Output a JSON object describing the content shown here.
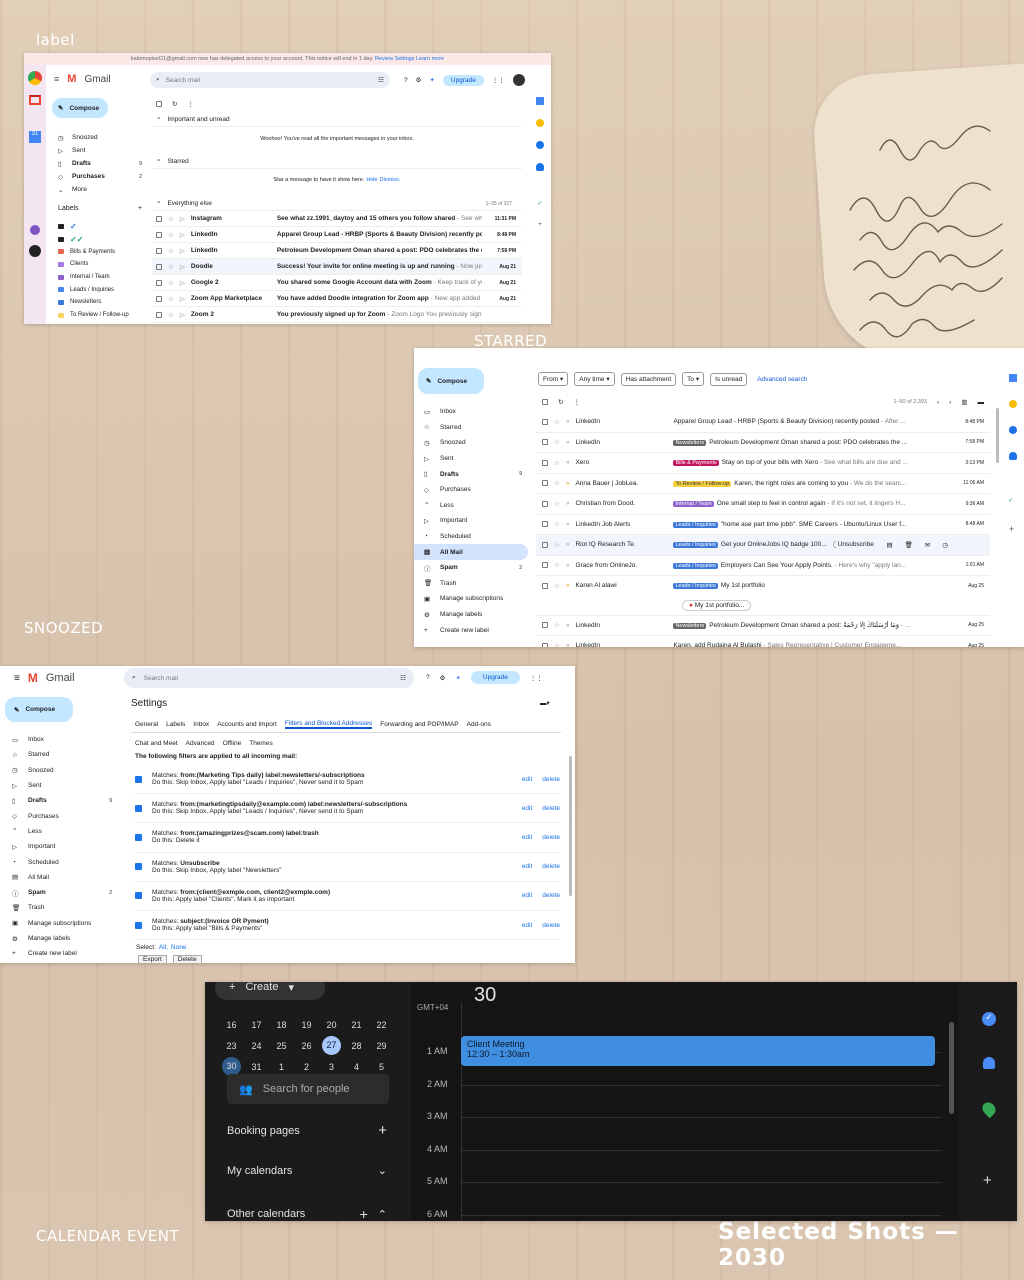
{
  "captions": {
    "label": "label",
    "starred": "STARRED",
    "snoozed": "SNOOZED",
    "calendar_event": "CALENDAR EVENT",
    "footer": "Selected Shots — 2030"
  },
  "colors": {
    "gmail_blue": "#0b57d0",
    "compose_bg": "#c2e7ff",
    "calendar_event": "#3f8ee0",
    "calendar_bg": "#1b1b1b",
    "upgrade_bg": "#c2e7ff"
  },
  "shot1": {
    "notice": "kalomopiseO1@gmail.com now has delegated access to your account. This notice will end in 1 day.",
    "notice_links": [
      "Review Settings",
      "Learn more"
    ],
    "app": "Gmail",
    "search_placeholder": "Search mail",
    "upgrade": "Upgrade",
    "compose": "Compose",
    "nav": [
      {
        "label": "Snoozed",
        "icon": "clock-icon",
        "count": ""
      },
      {
        "label": "Sent",
        "icon": "send-icon",
        "count": ""
      },
      {
        "label": "Drafts",
        "icon": "draft-icon",
        "count": "9"
      },
      {
        "label": "Purchases",
        "icon": "tag-icon",
        "count": "2"
      },
      {
        "label": "More",
        "icon": "chevron-down-icon",
        "count": ""
      }
    ],
    "labels_title": "Labels",
    "labels": [
      {
        "name": "✓",
        "color": "#1a73e8"
      },
      {
        "name": "✓✓",
        "color": "#16a765"
      },
      {
        "name": "Bills & Payments",
        "color": "#e66550"
      },
      {
        "name": "Clients",
        "color": "#a479e2"
      },
      {
        "name": "Internal / Team",
        "color": "#8e63ce"
      },
      {
        "name": "Leads / Inquiries",
        "color": "#4986e7"
      },
      {
        "name": "Newsletters",
        "color": "#3c78d8"
      },
      {
        "name": "To Review / Follow-up",
        "color": "#fad165"
      }
    ],
    "sections": {
      "important": "Important and unread",
      "important_msg": "Woohoo! You've read all the important messages in your inbox.",
      "starred": "Starred",
      "starred_msg": "Star a message to have it show here.",
      "starred_links": [
        "Hide",
        "Dismiss."
      ],
      "everything": "Everything else",
      "range": "1–35 of 327"
    },
    "emails": [
      {
        "sender": "Instagram",
        "subject": "See what zz.1991_daytoy and 15 others you follow shared",
        "snippet": " - See what's new...",
        "time": "11:31 PM"
      },
      {
        "sender": "LinkedIn",
        "subject": "Apparel Group Lead - HRBP (Sports & Beauty Division) recently posted",
        "snippet": " - A...",
        "time": "8:48 PM"
      },
      {
        "sender": "LinkedIn",
        "subject": "Petroleum Development Oman shared a post: PDO celebrates the comple...",
        "snippet": "",
        "time": "7:58 PM"
      },
      {
        "sender": "Doodle",
        "subject": "Success! Your invite for online meeting is up and running",
        "snippet": " - Now just invite your ...",
        "time": "Aug 21"
      },
      {
        "sender": "Google 2",
        "subject": "You shared some Google Account data with Zoom",
        "snippet": " - Keep track of your Goo...",
        "time": "Aug 21"
      },
      {
        "sender": "Zoom App Marketplace",
        "subject": "You have added Doodle integration for Zoom app",
        "snippet": " - New app added to your ...",
        "time": "Aug 21"
      },
      {
        "sender": "Zoom 2",
        "subject": "You previously signed up for Zoom",
        "snippet": " - Zoom Logo You previously sign...",
        "time": ""
      }
    ]
  },
  "shot2": {
    "compose": "Compose",
    "filters": [
      "From",
      "Any time",
      "Has attachment",
      "To",
      "Is unread"
    ],
    "advanced": "Advanced search",
    "range": "1–50 of 2,393",
    "nav": [
      {
        "label": "Inbox",
        "icon": "inbox-icon",
        "count": ""
      },
      {
        "label": "Starred",
        "icon": "star-icon",
        "count": ""
      },
      {
        "label": "Snoozed",
        "icon": "clock-icon",
        "count": ""
      },
      {
        "label": "Sent",
        "icon": "send-icon",
        "count": ""
      },
      {
        "label": "Drafts",
        "icon": "draft-icon",
        "count": "9"
      },
      {
        "label": "Purchases",
        "icon": "tag-icon",
        "count": ""
      },
      {
        "label": "Less",
        "icon": "chevron-up-icon",
        "count": ""
      },
      {
        "label": "Important",
        "icon": "important-icon",
        "count": ""
      },
      {
        "label": "Scheduled",
        "icon": "scheduled-icon",
        "count": ""
      },
      {
        "label": "All Mail",
        "icon": "allmail-icon",
        "count": ""
      },
      {
        "label": "Spam",
        "icon": "spam-icon",
        "count": "2"
      },
      {
        "label": "Trash",
        "icon": "trash-icon",
        "count": ""
      },
      {
        "label": "Manage subscriptions",
        "icon": "subscriptions-icon",
        "count": ""
      },
      {
        "label": "Manage labels",
        "icon": "gear-icon",
        "count": ""
      },
      {
        "label": "Create new label",
        "icon": "plus-icon",
        "count": ""
      }
    ],
    "active_nav": "All Mail",
    "emails": [
      {
        "sender": "LinkedIn",
        "chip": "",
        "chip_color": "",
        "subject": "Apparel Group Lead - HRBP (Sports & Beauty Division) recently posted",
        "snippet": " - After ...",
        "time": "8:48 PM"
      },
      {
        "sender": "LinkedIn",
        "chip": "Newsletters",
        "chip_color": "#666",
        "subject": "Petroleum Development Oman shared a post: PDO celebrates the ...",
        "snippet": "",
        "time": "7:58 PM"
      },
      {
        "sender": "Xero",
        "chip": "Bills & Payments",
        "chip_color": "#c2185b",
        "subject": "Stay on top of your bills with Xero",
        "snippet": " - See what bills are due and ...",
        "time": "3:13 PM"
      },
      {
        "sender": "Anna Bauer | JobLea.",
        "chip": "To Review / Follow-up",
        "chip_color": "#f4d03f",
        "subject": "Karen, the right roles are coming to you",
        "snippet": " - We do the searc...",
        "time": "11:06 AM"
      },
      {
        "sender": "Christian from Dood.",
        "chip": "Internal / Team",
        "chip_color": "#8e63ce",
        "subject": "One small step to feel in control again",
        "snippet": " - If it's not set, it lingers H...",
        "time": "9:36 AM"
      },
      {
        "sender": "LinkedIn Job Alerts",
        "chip": "Leads / Inquiries",
        "chip_color": "#3c78d8",
        "subject": "\"home ase part time jobb\": SME Careers - Ubuntu/Linux User f...",
        "snippet": "",
        "time": "8:48 AM"
      },
      {
        "sender": "Riot IQ Research Te.",
        "chip": "Leads / Inquiries",
        "chip_color": "#3c78d8",
        "subject": "Get your OnlineJobs IQ badge 100...",
        "snippet": "",
        "time": "",
        "unsubscribe": "Unsubscribe"
      },
      {
        "sender": "Grace from OnlineJo.",
        "chip": "Leads / Inquiries",
        "chip_color": "#3c78d8",
        "subject": "Employers Can See Your Apply Points.",
        "snippet": " - Here's why \"apply lan...",
        "time": "1:01 AM"
      },
      {
        "sender": "Karen Al alawi",
        "chip": "Leads / Inquiries",
        "chip_color": "#3c78d8",
        "subject": "My 1st portfolio",
        "snippet": "",
        "time": "Aug 25",
        "attachment": "My 1st portfolio..."
      },
      {
        "sender": "LinkedIn",
        "chip": "Newsletters",
        "chip_color": "#666",
        "subject": "Petroleum Development Oman shared a post: وَمَا أَرْسَلْنَاكَ إِلَّا رَحْمَةً",
        "snippet": " - ...",
        "time": "Aug 25"
      },
      {
        "sender": "LinkedIn",
        "chip": "",
        "chip_color": "",
        "subject": "Karen, add Rudaina Al Bulashi",
        "snippet": " - Sales Representative | Customer Engageme...",
        "time": "Aug 25"
      }
    ]
  },
  "shot3": {
    "app": "Gmail",
    "search_placeholder": "Search mail",
    "upgrade": "Upgrade",
    "compose": "Compose",
    "title": "Settings",
    "tabs_row1": [
      "General",
      "Labels",
      "Inbox",
      "Accounts and Import",
      "Filters and Blocked Addresses",
      "Forwarding and POP/IMAP",
      "Add-ons"
    ],
    "tabs_row2": [
      "Chat and Meet",
      "Advanced",
      "Offline",
      "Themes"
    ],
    "active_tab": "Filters and Blocked Addresses",
    "intro": "The following filters are applied to all incoming mail:",
    "nav": [
      {
        "label": "Inbox",
        "count": ""
      },
      {
        "label": "Starred",
        "count": ""
      },
      {
        "label": "Snoozed",
        "count": ""
      },
      {
        "label": "Sent",
        "count": ""
      },
      {
        "label": "Drafts",
        "count": "9"
      },
      {
        "label": "Purchases",
        "count": ""
      },
      {
        "label": "Less",
        "count": ""
      },
      {
        "label": "Important",
        "count": ""
      },
      {
        "label": "Scheduled",
        "count": ""
      },
      {
        "label": "All Mail",
        "count": ""
      },
      {
        "label": "Spam",
        "count": "2"
      },
      {
        "label": "Trash",
        "count": ""
      },
      {
        "label": "Manage subscriptions",
        "count": ""
      },
      {
        "label": "Manage labels",
        "count": ""
      },
      {
        "label": "Create new label",
        "count": ""
      }
    ],
    "filters": [
      {
        "matches": "from:(Marketing Tips daily) label:newsletters/-subscriptions",
        "action": "Do this: Skip Inbox, Apply label \"Leads / Inquiries\", Never send it to Spam"
      },
      {
        "matches": "from:(marketingtipsdaily@example.com) label:newsletters/-subscriptions",
        "action": "Do this: Skip Inbox, Apply label \"Leads / Inquiries\", Never send it to Spam"
      },
      {
        "matches": "from:(amazingprizes@scam.com) label:trash",
        "action": "Do this: Delete it"
      },
      {
        "matches": "Unsubscribe",
        "action": "Do this: Skip Inbox, Apply label \"Newsletters\""
      },
      {
        "matches": "from:(client@exmple.com, client2@exmple.com)",
        "action": "Do this: Apply label \"Clients\", Mark it as important"
      },
      {
        "matches": "subject:(Invoice OR Pyment)",
        "action": "Do this: Apply label \"Bills & Payments\""
      }
    ],
    "matches_prefix": "Matches: ",
    "edit": "edit",
    "delete": "delete",
    "select": "Select:",
    "select_all": "All,",
    "select_none": "None",
    "export": "Export",
    "delete_btn": "Delete"
  },
  "shot4": {
    "create": "Create",
    "date_header": "30",
    "timezone": "GMT+04",
    "weeks": [
      [
        "16",
        "17",
        "18",
        "19",
        "20",
        "21",
        "22"
      ],
      [
        "23",
        "24",
        "25",
        "26",
        "27",
        "28",
        "29"
      ],
      [
        "30",
        "31",
        "1",
        "2",
        "3",
        "4",
        "5"
      ]
    ],
    "today": "27",
    "selected": "30",
    "search_people": "Search for people",
    "booking": "Booking pages",
    "my_calendars": "My calendars",
    "other_calendars": "Other calendars",
    "hours": [
      "1 AM",
      "2 AM",
      "3 AM",
      "4 AM",
      "5 AM",
      "6 AM"
    ],
    "event": {
      "title": "Client Meeting",
      "time": "12:30 – 1:30am"
    }
  }
}
